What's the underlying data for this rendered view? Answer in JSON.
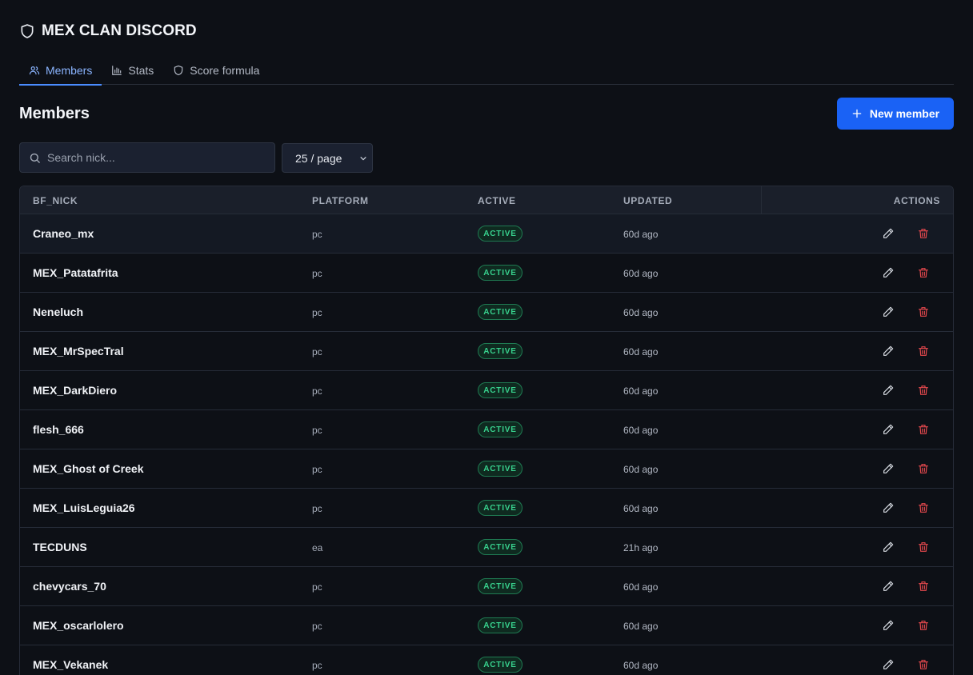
{
  "app": {
    "title": "MEX CLAN DISCORD",
    "logo_icon": "shield-icon"
  },
  "tabs": [
    {
      "label": "Members",
      "icon": "users-icon",
      "active": true
    },
    {
      "label": "Stats",
      "icon": "bar-chart-icon",
      "active": false
    },
    {
      "label": "Score formula",
      "icon": "shield-icon",
      "active": false
    }
  ],
  "main": {
    "title": "Members",
    "new_button_label": "New member",
    "search_placeholder": "Search nick...",
    "page_size_label": "25 / page"
  },
  "table": {
    "columns": {
      "nick": "BF_NICK",
      "platform": "PLATFORM",
      "active": "ACTIVE",
      "updated": "UPDATED",
      "actions": "ACTIONS"
    },
    "rows": [
      {
        "nick": "Craneo_mx",
        "platform": "pc",
        "status": "ACTIVE",
        "updated": "60d ago"
      },
      {
        "nick": "MEX_Patatafrita",
        "platform": "pc",
        "status": "ACTIVE",
        "updated": "60d ago"
      },
      {
        "nick": "Neneluch",
        "platform": "pc",
        "status": "ACTIVE",
        "updated": "60d ago"
      },
      {
        "nick": "MEX_MrSpecTral",
        "platform": "pc",
        "status": "ACTIVE",
        "updated": "60d ago"
      },
      {
        "nick": "MEX_DarkDiero",
        "platform": "pc",
        "status": "ACTIVE",
        "updated": "60d ago"
      },
      {
        "nick": "flesh_666",
        "platform": "pc",
        "status": "ACTIVE",
        "updated": "60d ago"
      },
      {
        "nick": "MEX_Ghost of Creek",
        "platform": "pc",
        "status": "ACTIVE",
        "updated": "60d ago"
      },
      {
        "nick": "MEX_LuisLeguia26",
        "platform": "pc",
        "status": "ACTIVE",
        "updated": "60d ago"
      },
      {
        "nick": "TECDUNS",
        "platform": "ea",
        "status": "ACTIVE",
        "updated": "21h ago"
      },
      {
        "nick": "chevycars_70",
        "platform": "pc",
        "status": "ACTIVE",
        "updated": "60d ago"
      },
      {
        "nick": "MEX_oscarlolero",
        "platform": "pc",
        "status": "ACTIVE",
        "updated": "60d ago"
      },
      {
        "nick": "MEX_Vekanek",
        "platform": "pc",
        "status": "ACTIVE",
        "updated": "60d ago"
      }
    ]
  },
  "colors": {
    "background": "#0d1016",
    "accent": "#1a62f5",
    "active_tab": "#8ab4ff",
    "status_active": "#38d28e",
    "delete": "#e5484d"
  }
}
